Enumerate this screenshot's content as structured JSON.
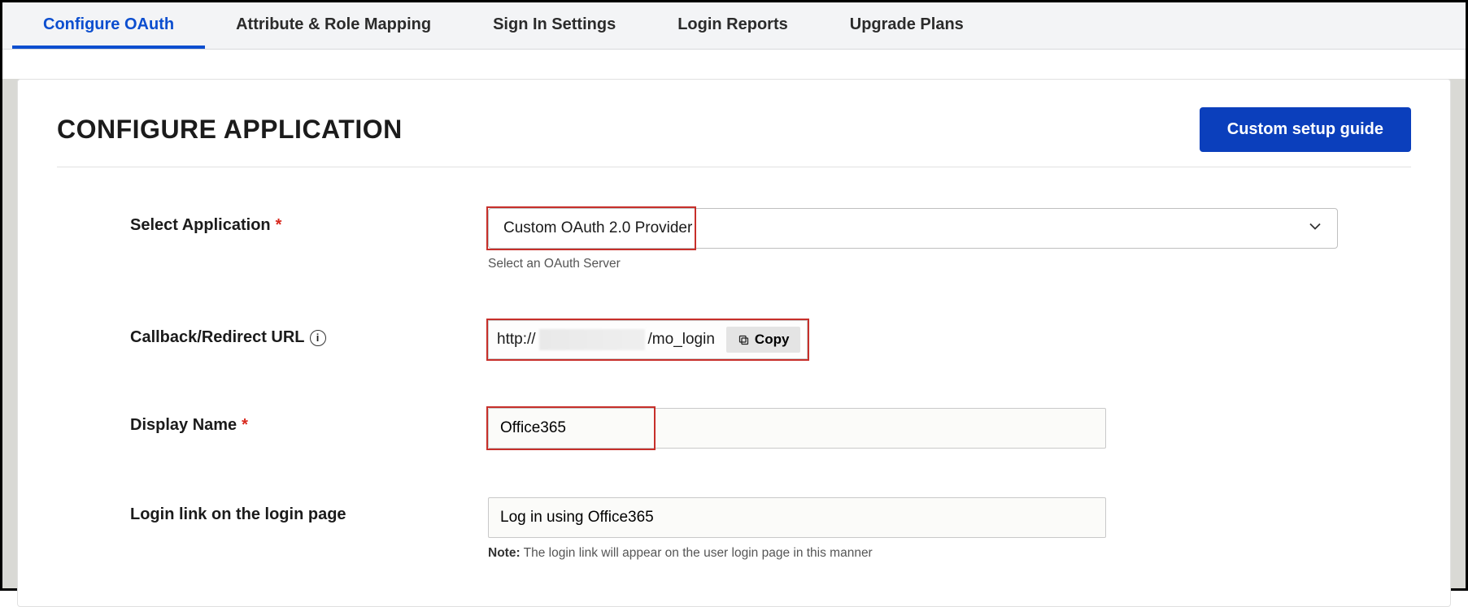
{
  "tabs": {
    "t0": "Configure OAuth",
    "t1": "Attribute & Role Mapping",
    "t2": "Sign In Settings",
    "t3": "Login Reports",
    "t4": "Upgrade Plans"
  },
  "page": {
    "title": "CONFIGURE APPLICATION",
    "setup_btn": "Custom setup guide"
  },
  "form": {
    "select_app": {
      "label": "Select Application",
      "value": "Custom OAuth 2.0 Provider",
      "hint": "Select an OAuth Server"
    },
    "callback": {
      "label": "Callback/Redirect URL",
      "prefix": "http://",
      "suffix": "/mo_login",
      "copy": "Copy"
    },
    "display_name": {
      "label": "Display Name",
      "value": "Office365"
    },
    "login_link": {
      "label": "Login link on the login page",
      "value": "Log in using Office365",
      "note_label": "Note:",
      "note_text": " The login link will appear on the user login page in this manner"
    }
  }
}
